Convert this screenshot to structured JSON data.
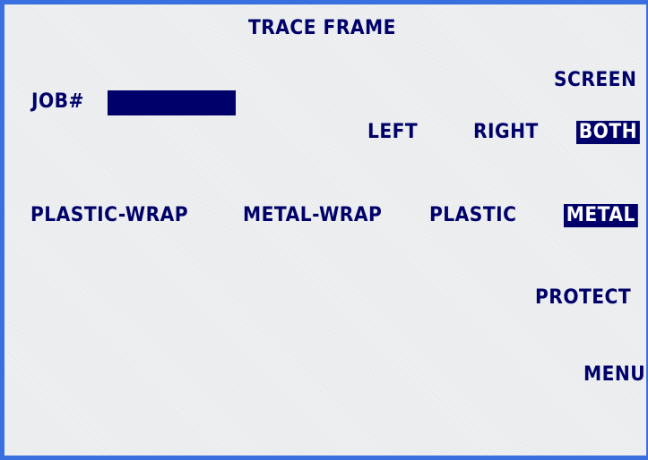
{
  "title": "TRACE FRAME",
  "job": {
    "label": "JOB#",
    "value": ""
  },
  "screen": {
    "label": "SCREEN",
    "options": [
      {
        "label": "LEFT",
        "selected": false
      },
      {
        "label": "RIGHT",
        "selected": false
      },
      {
        "label": "BOTH",
        "selected": true
      }
    ]
  },
  "frame_type": {
    "options": [
      {
        "label": "PLASTIC-WRAP",
        "selected": false
      },
      {
        "label": "METAL-WRAP",
        "selected": false
      },
      {
        "label": "PLASTIC",
        "selected": false
      },
      {
        "label": "METAL",
        "selected": true
      }
    ]
  },
  "actions": {
    "protect": "PROTECT",
    "menu": "MENU"
  },
  "colors": {
    "text": "#00006a",
    "highlight_bg": "#00006a",
    "highlight_text": "#ffffff",
    "border": "#3a6fe0",
    "background": "#eef0f2"
  }
}
